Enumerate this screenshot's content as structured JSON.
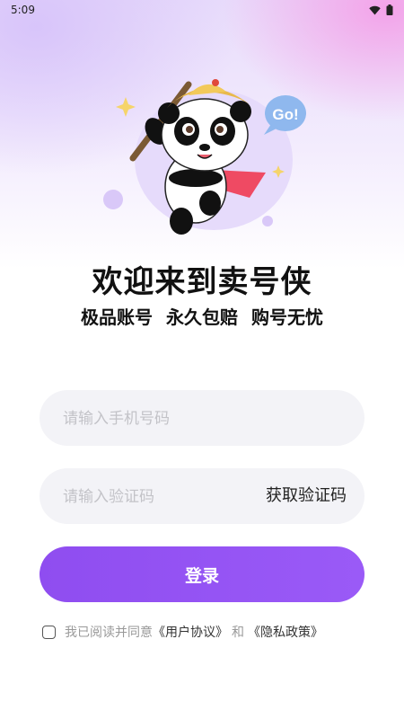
{
  "status_bar": {
    "time": "5:09"
  },
  "hero": {
    "bubble_text": "Go!",
    "welcome_title": "欢迎来到卖号侠",
    "slogan": "极品账号 永久包赔 购号无忧"
  },
  "form": {
    "phone_placeholder": "请输入手机号码",
    "code_placeholder": "请输入验证码",
    "get_code_label": "获取验证码",
    "login_label": "登录"
  },
  "agreement": {
    "prefix": "我已阅读并同意",
    "user_agreement": "《用户协议》",
    "and": "和",
    "privacy_policy": "《隐私政策》"
  },
  "colors": {
    "accent": "#9a5af7",
    "field_bg": "#f3f3f7",
    "placeholder": "#c3c3c8"
  }
}
